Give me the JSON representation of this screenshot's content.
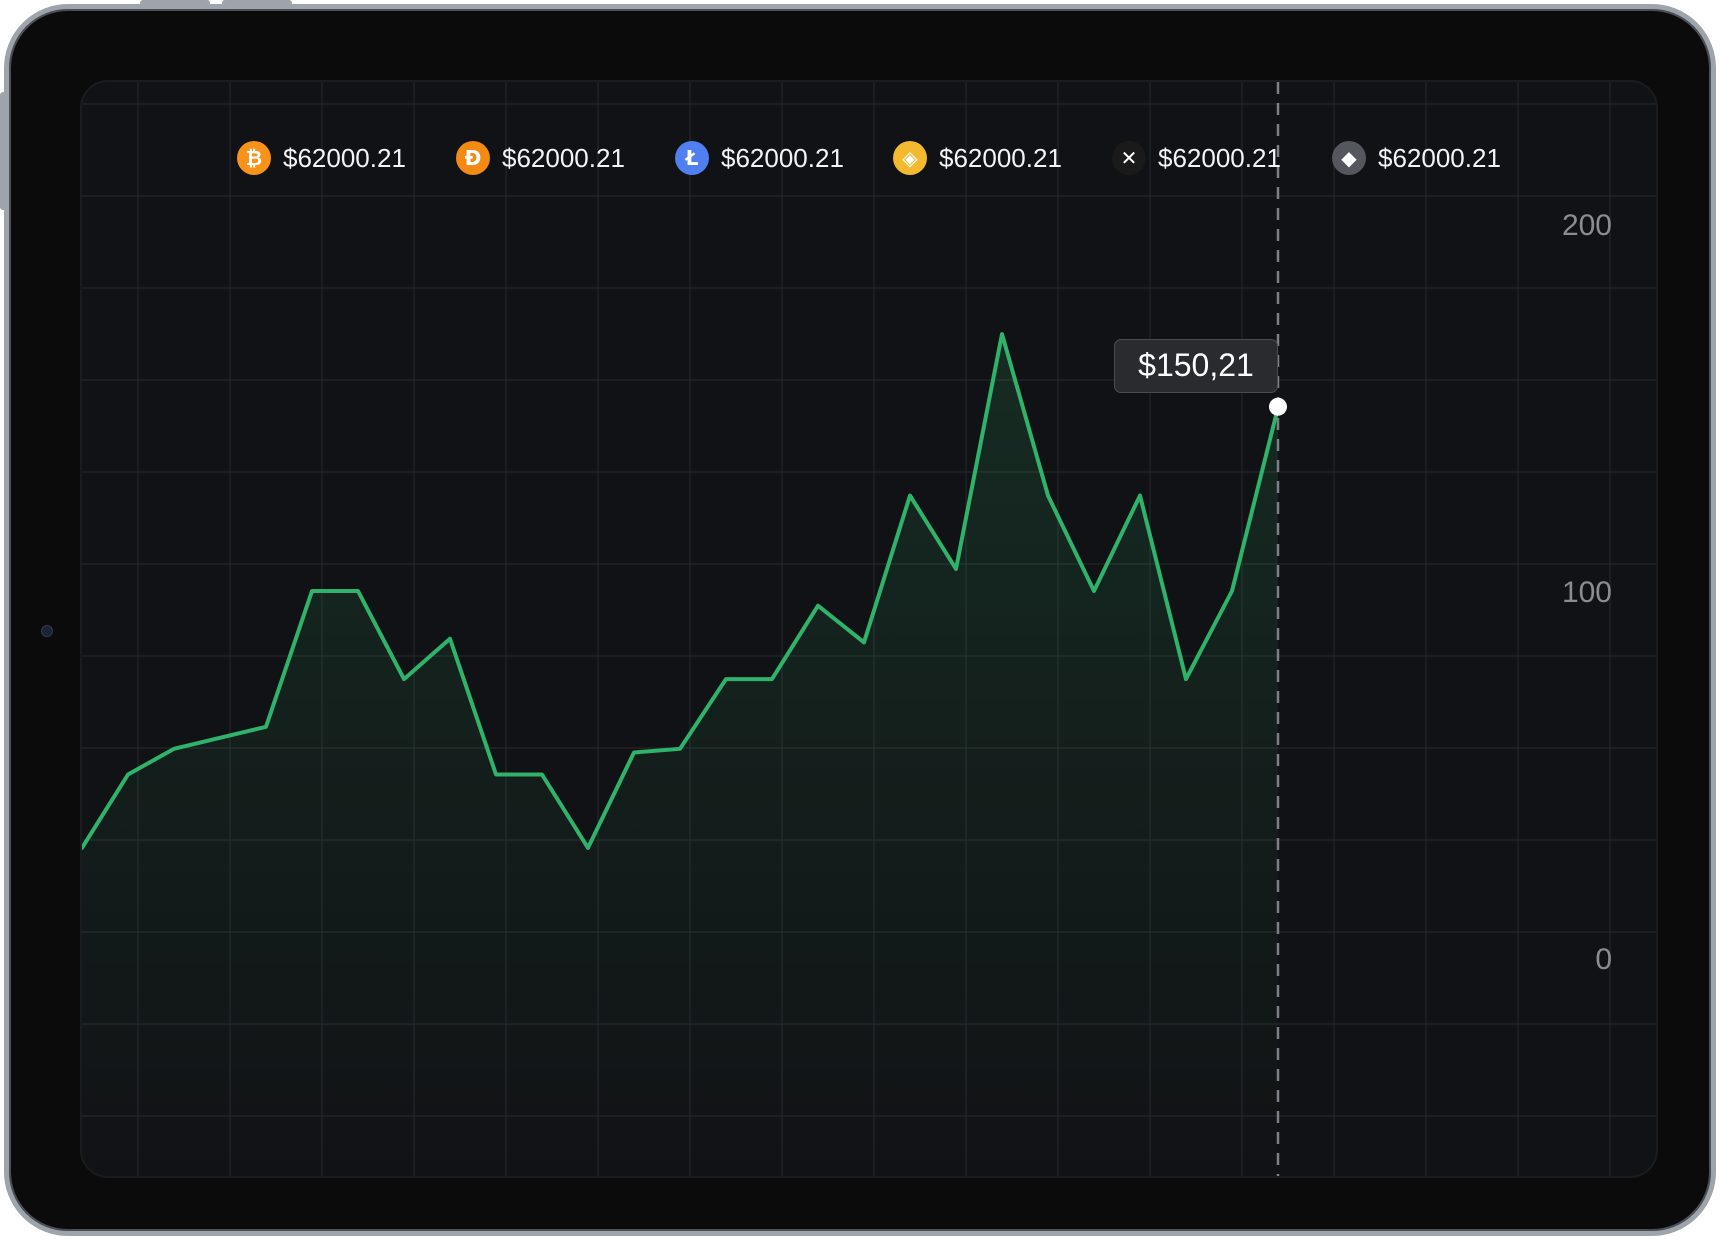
{
  "tickers": [
    {
      "icon": "bitcoin-icon",
      "symbol": "₿",
      "color": "#f7931a",
      "value": "$62000.21"
    },
    {
      "icon": "dogecoin-icon",
      "symbol": "Đ",
      "color": "#f28a14",
      "value": "$62000.21"
    },
    {
      "icon": "litecoin-icon",
      "symbol": "Ł",
      "color": "#4f7ff0",
      "value": "$62000.21"
    },
    {
      "icon": "binance-icon",
      "symbol": "◈",
      "color": "#f3ba2f",
      "value": "$62000.21"
    },
    {
      "icon": "xrp-icon",
      "symbol": "✕",
      "color": "#1a1a1a",
      "value": "$62000.21"
    },
    {
      "icon": "ethereum-icon",
      "symbol": "◆",
      "color": "#55575e",
      "value": "$62000.21"
    }
  ],
  "tooltip": {
    "value": "$150,21"
  },
  "colors": {
    "line": "#2fb36a",
    "background": "#111215",
    "grid": "#25272b"
  },
  "chart_data": {
    "type": "line",
    "title": "",
    "xlabel": "",
    "ylabel": "",
    "ylim": [
      -40,
      220
    ],
    "yticks": [
      0,
      100,
      200
    ],
    "y_axis_position": "right",
    "grid": true,
    "legend": "none",
    "series": [
      {
        "values": [
          30,
          50,
          57,
          60,
          63,
          100,
          100,
          76,
          87,
          50,
          50,
          30,
          56,
          57,
          76,
          76,
          96,
          86,
          126,
          106,
          170,
          126,
          100,
          126,
          76,
          100,
          150
        ]
      }
    ],
    "highlight": {
      "index": 26,
      "value": 150.21
    }
  }
}
